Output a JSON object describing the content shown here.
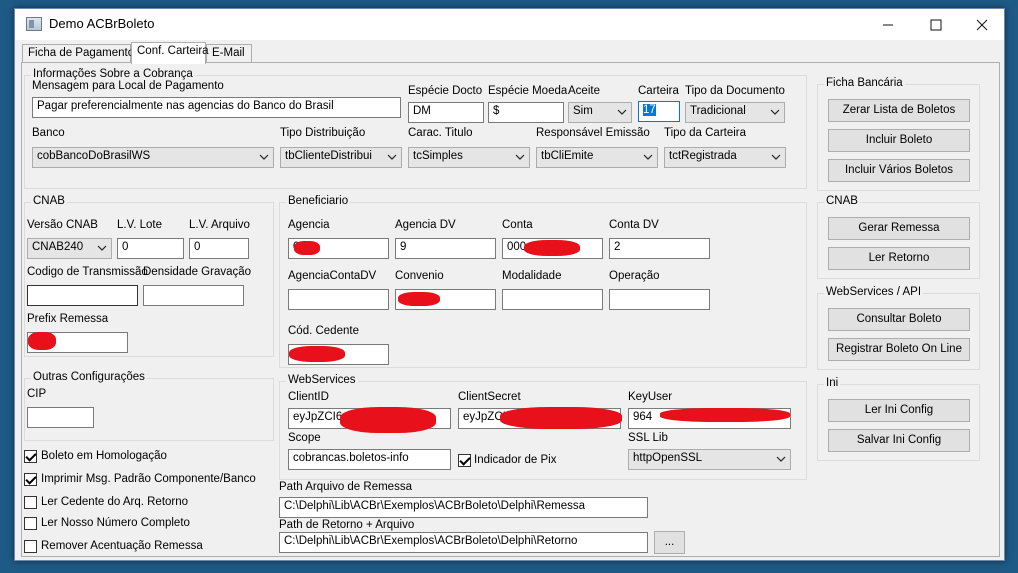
{
  "window": {
    "title": "Demo ACBrBoleto",
    "controls": [
      "minimize",
      "maximize",
      "close"
    ]
  },
  "tabs": [
    "Ficha de Pagamento",
    "Conf. Carteira",
    "E-Mail"
  ],
  "active_tab": "Conf. Carteira",
  "cobranca": {
    "group_title": "Informações Sobre a Cobrança",
    "mensagem_label": "Mensagem para Local de Pagamento",
    "mensagem_value": "Pagar preferencialmente nas agencias do Banco do Brasil",
    "especie_docto_label": "Espécie Docto",
    "especie_docto_value": "DM",
    "especie_moeda_label": "Espécie Moeda",
    "especie_moeda_value": "$",
    "aceite_label": "Aceite",
    "aceite_value": "Sim",
    "carteira_label": "Carteira",
    "carteira_value": "17",
    "tipo_documento_label": "Tipo da Documento",
    "tipo_documento_value": "Tradicional",
    "banco_label": "Banco",
    "banco_value": "cobBancoDoBrasilWS",
    "tipo_distribuicao_label": "Tipo Distribuição",
    "tipo_distribuicao_value": "tbClienteDistribui",
    "carac_titulo_label": "Carac. Titulo",
    "carac_titulo_value": "tcSimples",
    "responsavel_emissao_label": "Responsável Emissão",
    "responsavel_emissao_value": "tbCliEmite",
    "tipo_carteira_label": "Tipo da Carteira",
    "tipo_carteira_value": "tctRegistrada"
  },
  "ficha_bancaria": {
    "group_title": "Ficha Bancária",
    "buttons": [
      "Zerar Lista de Boletos",
      "Incluir Boleto",
      "Incluir Vários Boletos"
    ]
  },
  "cnab_right": {
    "group_title": "CNAB",
    "buttons": [
      "Gerar Remessa",
      "Ler Retorno"
    ]
  },
  "webservices_api": {
    "group_title": "WebServices / API",
    "buttons": [
      "Consultar Boleto",
      "Registrar Boleto On Line"
    ]
  },
  "ini": {
    "group_title": "Ini",
    "buttons": [
      "Ler Ini Config",
      "Salvar Ini Config"
    ]
  },
  "cnab": {
    "group_title": "CNAB",
    "versao_label": "Versão CNAB",
    "versao_value": "CNAB240",
    "lv_lote_label": "L.V. Lote",
    "lv_lote_value": "0",
    "lv_arquivo_label": "L.V. Arquivo",
    "lv_arquivo_value": "0",
    "codigo_transmissao_label": "Codigo de Transmissão",
    "codigo_transmissao_value": "",
    "densidade_label": "Densidade Gravação",
    "densidade_value": "",
    "prefix_remessa_label": "Prefix Remessa"
  },
  "outras": {
    "group_title": "Outras Configurações",
    "cip_label": "CIP",
    "cip_value": ""
  },
  "checkboxes": [
    {
      "label": "Boleto em Homologação",
      "checked": true
    },
    {
      "label": "Imprimir Msg. Padrão Componente/Banco",
      "checked": true
    },
    {
      "label": "Ler Cedente do Arq. Retorno",
      "checked": false
    },
    {
      "label": "Ler Nosso Número Completo",
      "checked": false
    },
    {
      "label": "Remover Acentuação Remessa",
      "checked": false
    }
  ],
  "beneficiario": {
    "group_title": "Beneficiario",
    "agencia_label": "Agencia",
    "agencia_value": "0",
    "agencia_dv_label": "Agencia DV",
    "agencia_dv_value": "9",
    "conta_label": "Conta",
    "conta_value": "000",
    "conta_dv_label": "Conta DV",
    "conta_dv_value": "2",
    "agencia_conta_dv_label": "AgenciaContaDV",
    "agencia_conta_dv_value": "",
    "convenio_label": "Convenio",
    "modalidade_label": "Modalidade",
    "modalidade_value": "",
    "operacao_label": "Operação",
    "operacao_value": "",
    "cod_cedente_label": "Cód. Cedente"
  },
  "webservices": {
    "group_title": "WebServices",
    "client_id_label": "ClientID",
    "client_id_value": "eyJpZCI6",
    "client_secret_label": "ClientSecret",
    "client_secret_value": "eyJpZCI",
    "key_user_label": "KeyUser",
    "key_user_value": "964",
    "scope_label": "Scope",
    "scope_value": "cobrancas.boletos-info",
    "indicador_pix_label": "Indicador de Pix",
    "indicador_pix_checked": true,
    "ssl_lib_label": "SSL Lib",
    "ssl_lib_value": "httpOpenSSL"
  },
  "paths": {
    "remessa_label": "Path Arquivo de Remessa",
    "remessa_value": "C:\\Delphi\\Lib\\ACBr\\Exemplos\\ACBrBoleto\\Delphi\\Remessa",
    "retorno_label": "Path de Retorno + Arquivo",
    "retorno_value": "C:\\Delphi\\Lib\\ACBr\\Exemplos\\ACBrBoleto\\Delphi\\Retorno",
    "browse_label": "..."
  },
  "colors": {
    "redaction": "#e8101a",
    "focus": "#0078d7"
  }
}
